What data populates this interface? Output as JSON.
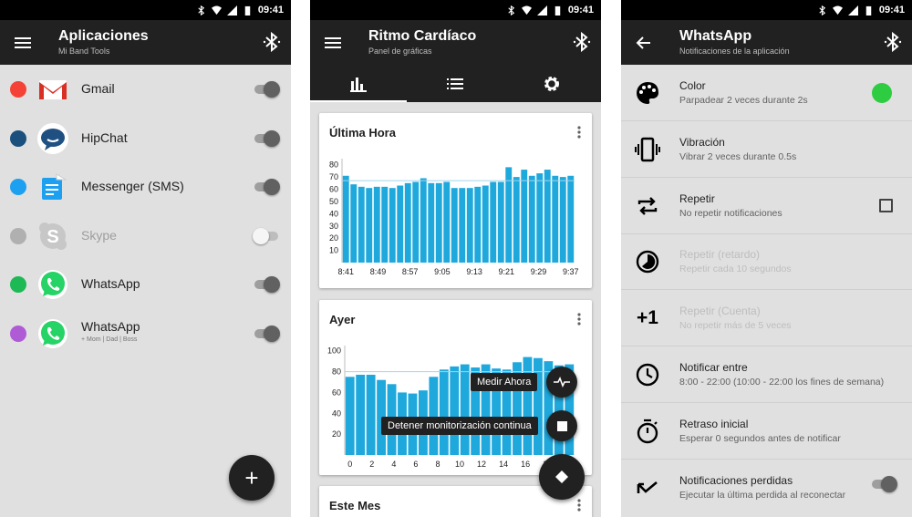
{
  "status_time": "09:41",
  "panel1": {
    "title": "Aplicaciones",
    "subtitle": "Mi Band Tools",
    "apps": [
      {
        "name": "Gmail",
        "dot": "#f44336",
        "icon": "gmail-icon",
        "on": true,
        "sub": ""
      },
      {
        "name": "HipChat",
        "dot": "#1a4f7e",
        "icon": "hipchat-icon",
        "on": true,
        "sub": ""
      },
      {
        "name": "Messenger (SMS)",
        "dot": "#1ea0f0",
        "icon": "messenger-icon",
        "on": true,
        "sub": ""
      },
      {
        "name": "Skype",
        "dot": "#b0b0b0",
        "icon": "skype-icon",
        "on": false,
        "sub": ""
      },
      {
        "name": "WhatsApp",
        "dot": "#1db954",
        "icon": "whatsapp-icon",
        "on": true,
        "sub": ""
      },
      {
        "name": "WhatsApp",
        "dot": "#b05bd6",
        "icon": "whatsapp-icon",
        "on": true,
        "sub": "+ Mom | Dad | Boss"
      }
    ],
    "fab_label": "+"
  },
  "panel2": {
    "title": "Ritmo Cardíaco",
    "subtitle": "Panel de gráficas",
    "tabs": [
      "chart-tab",
      "list-tab",
      "settings-tab"
    ],
    "cards": [
      {
        "title": "Última Hora",
        "chart_data": {
          "type": "bar",
          "yticks": [
            10,
            20,
            30,
            40,
            50,
            60,
            70,
            80
          ],
          "ylim": [
            0,
            85
          ],
          "xticks": [
            "8:41",
            "8:49",
            "8:57",
            "9:05",
            "9:13",
            "9:21",
            "9:29",
            "9:37"
          ],
          "reference_line": 67,
          "values": [
            71,
            64,
            62,
            61,
            62,
            62,
            61,
            63,
            65,
            66,
            69,
            65,
            65,
            66,
            61,
            61,
            61,
            62,
            63,
            66,
            66,
            78,
            70,
            76,
            71,
            73,
            76,
            71,
            70,
            71
          ]
        }
      },
      {
        "title": "Ayer",
        "chart_data": {
          "type": "bar",
          "yticks": [
            20,
            40,
            60,
            80,
            100
          ],
          "ylim": [
            0,
            105
          ],
          "xticks": [
            "0",
            "2",
            "4",
            "6",
            "8",
            "10",
            "12",
            "14",
            "16",
            "18",
            "20"
          ],
          "reference_line": 80,
          "values": [
            75,
            77,
            77,
            72,
            68,
            60,
            59,
            62,
            75,
            82,
            85,
            87,
            84,
            87,
            83,
            82,
            89,
            94,
            93,
            90,
            86,
            87
          ]
        }
      },
      {
        "title": "Este Mes"
      }
    ],
    "fab_chips": [
      "Medir Ahora",
      "Detener monitorización continua"
    ]
  },
  "panel3": {
    "title": "WhatsApp",
    "subtitle": "Notificaciones de la aplicación",
    "settings": [
      {
        "title": "Color",
        "sub": "Parpadear 2 veces durante 2s",
        "icon": "palette-icon",
        "dim": false,
        "control": "color"
      },
      {
        "title": "Vibración",
        "sub": "Vibrar 2 veces durante 0.5s",
        "icon": "vibration-icon",
        "dim": false,
        "control": ""
      },
      {
        "title": "Repetir",
        "sub": "No repetir notificaciones",
        "icon": "repeat-icon",
        "dim": false,
        "control": "checkbox"
      },
      {
        "title": "Repetir (retardo)",
        "sub": "Repetir cada 10 segundos",
        "icon": "timelapse-icon",
        "dim": true,
        "control": ""
      },
      {
        "title": "Repetir (Cuenta)",
        "sub": "No repetir más de 5 veces",
        "icon": "plus-one-icon",
        "dim": true,
        "control": ""
      },
      {
        "title": "Notificar entre",
        "sub": "8:00 - 22:00 (10:00 - 22:00 los fines de semana)",
        "icon": "clock-icon",
        "dim": false,
        "control": ""
      },
      {
        "title": "Retraso inicial",
        "sub": "Esperar 0 segundos antes de notificar",
        "icon": "timer-icon",
        "dim": false,
        "control": ""
      },
      {
        "title": "Notificaciones perdidas",
        "sub": "Ejecutar la última perdida al reconectar",
        "icon": "missed-icon",
        "dim": false,
        "control": "switch"
      }
    ],
    "plus_one_glyph": "+1",
    "accent_color": "#2ecc40"
  },
  "colors": {
    "bar": "#1fa8dc",
    "appbar": "#212121"
  }
}
